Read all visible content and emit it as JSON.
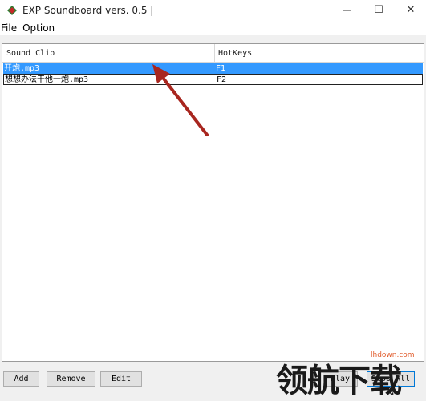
{
  "window": {
    "title": "EXP Soundboard vers. 0.5 |",
    "minimize_glyph": "—",
    "maximize_glyph": "☐",
    "close_glyph": "✕"
  },
  "menu": [
    "File",
    "Option"
  ],
  "list": {
    "columns": [
      "Sound Clip",
      "HotKeys"
    ],
    "rows": [
      {
        "clip": "开炮.mp3",
        "hotkey": "F1",
        "selected": true
      },
      {
        "clip": "想想办法干他一炮.mp3",
        "hotkey": "F2",
        "selected": false
      }
    ]
  },
  "buttons": {
    "add": "Add",
    "remove": "Remove",
    "edit": "Edit",
    "play": "Play",
    "stop_all": "Stop All"
  },
  "watermark": {
    "text": "领航下载",
    "url": "lhdown.com"
  },
  "colors": {
    "selection": "#3399ff",
    "arrow": "#a8261f",
    "watermark_accent": "#e05a2a"
  }
}
